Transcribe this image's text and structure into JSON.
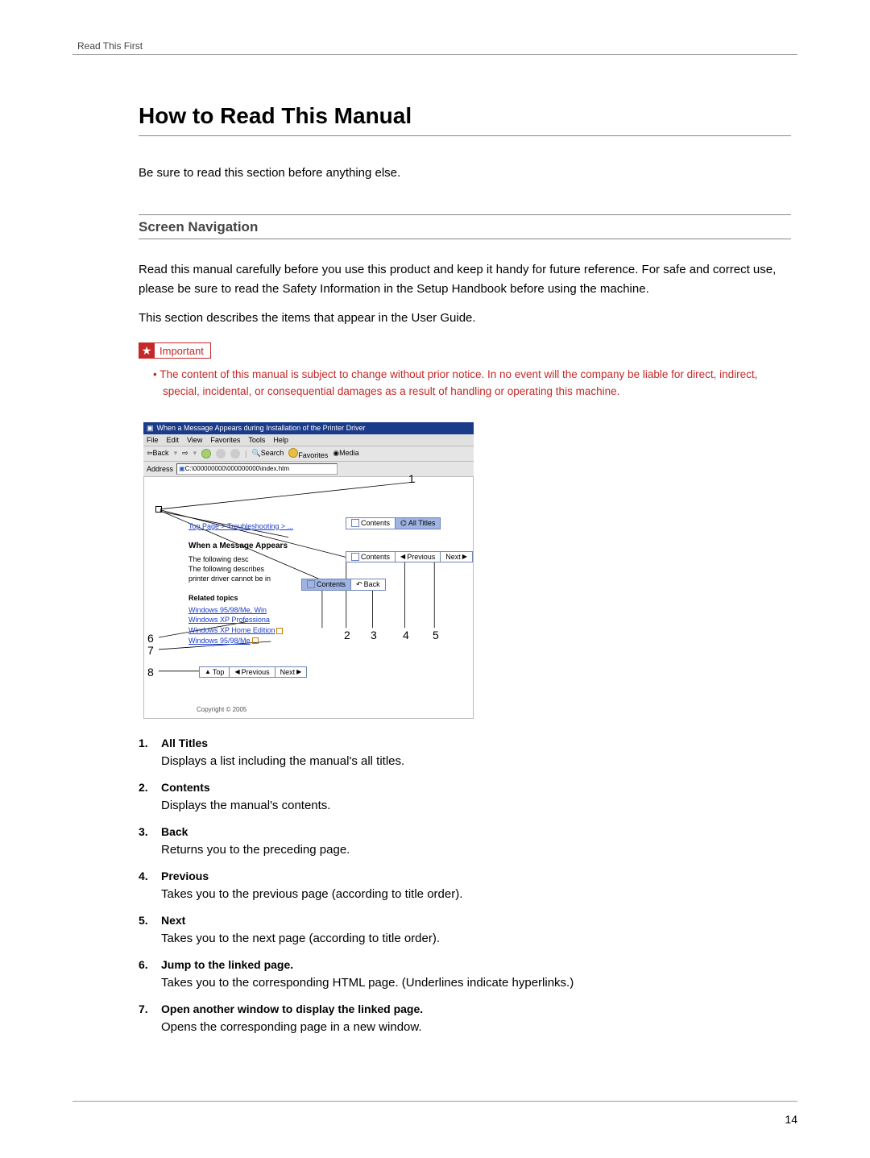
{
  "header": {
    "running": "Read This First"
  },
  "title": "How to Read This Manual",
  "intro": "Be sure to read this section before anything else.",
  "section": {
    "title": "Screen Navigation",
    "p1": "Read this manual carefully before you use this product and keep it handy for future reference. For safe and correct use, please be sure to read the Safety Information in the Setup Handbook before using the machine.",
    "p2": "This section describes the items that appear in the User Guide."
  },
  "important": {
    "label": "Important",
    "text": "The content of this manual is subject to change without prior notice. In no event will the company be liable for direct, indirect, special, incidental, or consequential damages as a result of handling or operating this machine."
  },
  "browser": {
    "title": "When a Message Appears during Installation of the Printer Driver",
    "menu": [
      "File",
      "Edit",
      "View",
      "Favorites",
      "Tools",
      "Help"
    ],
    "toolbar": {
      "back": "Back",
      "search": "Search",
      "favorites": "Favorites",
      "media": "Media"
    },
    "addressLabel": "Address",
    "addressValue": "C:\\000000000\\000000000\\index.htm",
    "breadcrumb": "Top Page > Troubleshooting > ...",
    "docHeading": "When a Message Appears",
    "docLine1": "The following desc",
    "docLine2a": "The following describes",
    "docLine2b": "printer driver cannot be in",
    "related": "Related topics",
    "link1": "Windows 95/98/Me, Win",
    "link2": "Windows XP Professiona",
    "link3": "Windows XP Home Edition",
    "link4": "Windows 95/98/Me",
    "nav": {
      "contents": "Contents",
      "allTitles": "All Titles",
      "back": "Back",
      "previous": "Previous",
      "next": "Next",
      "top": "Top"
    },
    "copyright": "Copyright © 2005"
  },
  "callouts": {
    "1": "1",
    "2": "2",
    "3": "3",
    "4": "4",
    "5": "5",
    "6": "6",
    "7": "7",
    "8": "8"
  },
  "legend": [
    {
      "term": "All Titles",
      "desc": "Displays a list including the manual's all titles."
    },
    {
      "term": "Contents",
      "desc": "Displays the manual's contents."
    },
    {
      "term": "Back",
      "desc": "Returns you to the preceding page."
    },
    {
      "term": "Previous",
      "desc": "Takes you to the previous page (according to title order)."
    },
    {
      "term": "Next",
      "desc": "Takes you to the next page (according to title order)."
    },
    {
      "term": "Jump to the linked page.",
      "desc": "Takes you to the corresponding HTML page. (Underlines indicate hyperlinks.)"
    },
    {
      "term": "Open another window to display the linked page.",
      "desc": "Opens the corresponding page in a new window."
    }
  ],
  "pageNumber": "14"
}
